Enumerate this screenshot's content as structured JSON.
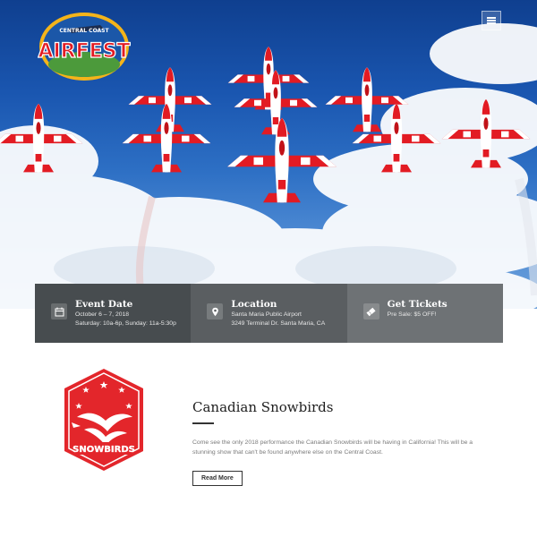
{
  "header": {
    "logo": {
      "top_text": "CENTRAL COAST",
      "main_text": "AIRFEST"
    },
    "menu_icon": "hamburger-menu-icon"
  },
  "info_bar": [
    {
      "icon": "calendar-icon",
      "title": "Event Date",
      "lines": [
        "October 6 – 7, 2018",
        "Saturday: 10a-6p, Sunday: 11a-5:30p"
      ]
    },
    {
      "icon": "map-pin-icon",
      "title": "Location",
      "lines": [
        "Santa Maria Public Airport",
        "3249 Terminal Dr. Santa Maria, CA"
      ]
    },
    {
      "icon": "ticket-icon",
      "title": "Get Tickets",
      "lines": [
        "Pre Sale: $5 OFF!"
      ]
    }
  ],
  "feature": {
    "badge_text": "SNOWBIRDS",
    "title": "Canadian Snowbirds",
    "body": "Come see the only 2018 performance the Canadian Snowbirds will be having in California! This will be a stunning show that can't be found anywhere else on the Central Coast.",
    "button_label": "Read More"
  },
  "colors": {
    "jet_red": "#e21b23",
    "sky_blue": "#1a56b0",
    "info_dark": "#474c4f",
    "info_mid": "#5a5e61",
    "info_light": "#6e7275",
    "badge_red": "#e3262b"
  }
}
